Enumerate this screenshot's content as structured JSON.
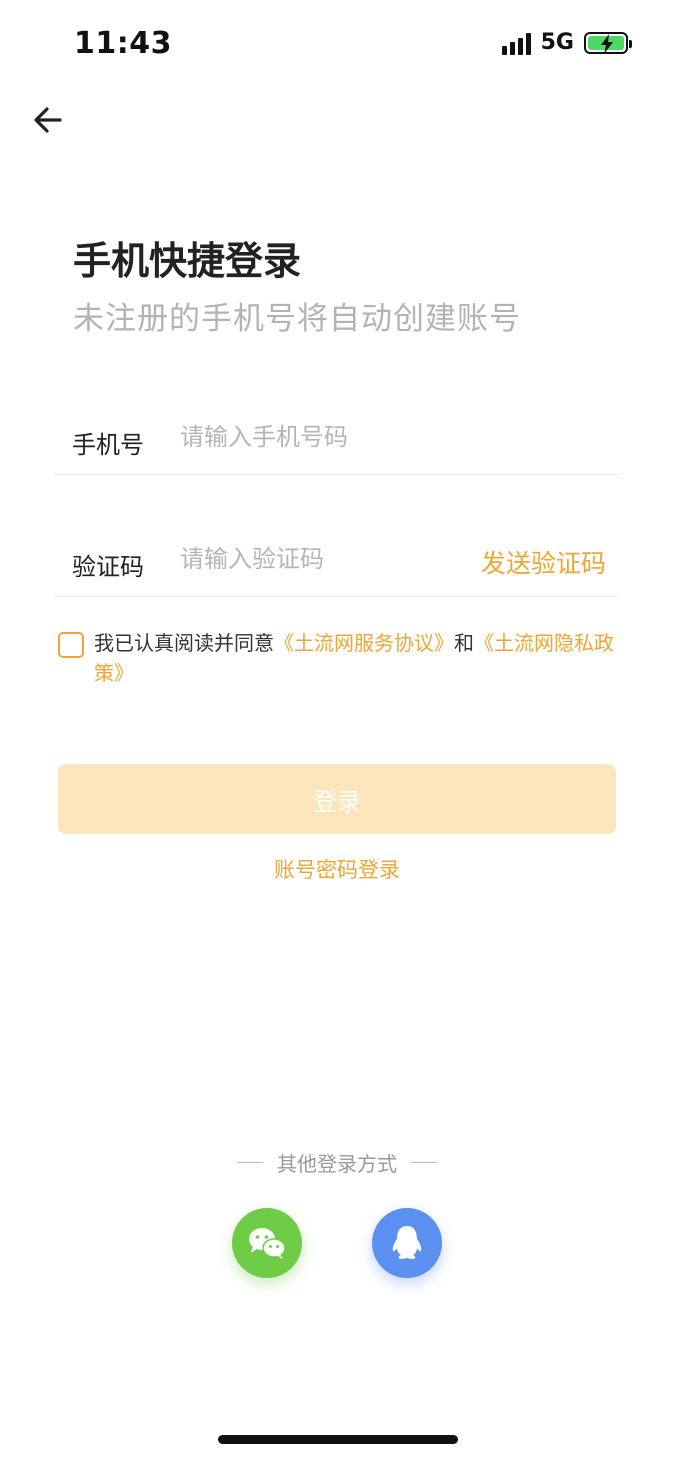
{
  "status_bar": {
    "time": "11:43",
    "network": "5G",
    "battery_charging": true
  },
  "header": {
    "back_icon": "arrow-left-icon"
  },
  "page": {
    "title": "手机快捷登录",
    "subtitle": "未注册的手机号将自动创建账号"
  },
  "form": {
    "phone_label": "手机号",
    "phone_placeholder": "请输入手机号码",
    "phone_value": "",
    "code_label": "验证码",
    "code_placeholder": "请输入验证码",
    "code_value": "",
    "send_code_label": "发送验证码"
  },
  "agreement": {
    "checked": false,
    "prefix": "我已认真阅读并同意",
    "service_link": "《土流网服务协议》",
    "and": "和",
    "privacy_link": "《土流网隐私政策》"
  },
  "actions": {
    "login_label": "登录",
    "password_login_label": "账号密码登录"
  },
  "other_login": {
    "label": "其他登录方式",
    "options": [
      "wechat-icon",
      "qq-icon"
    ]
  },
  "colors": {
    "accent": "#f0a534",
    "login_button_disabled": "#fbe5ba",
    "wechat": "#6fcc47",
    "qq": "#5b8ff0"
  }
}
